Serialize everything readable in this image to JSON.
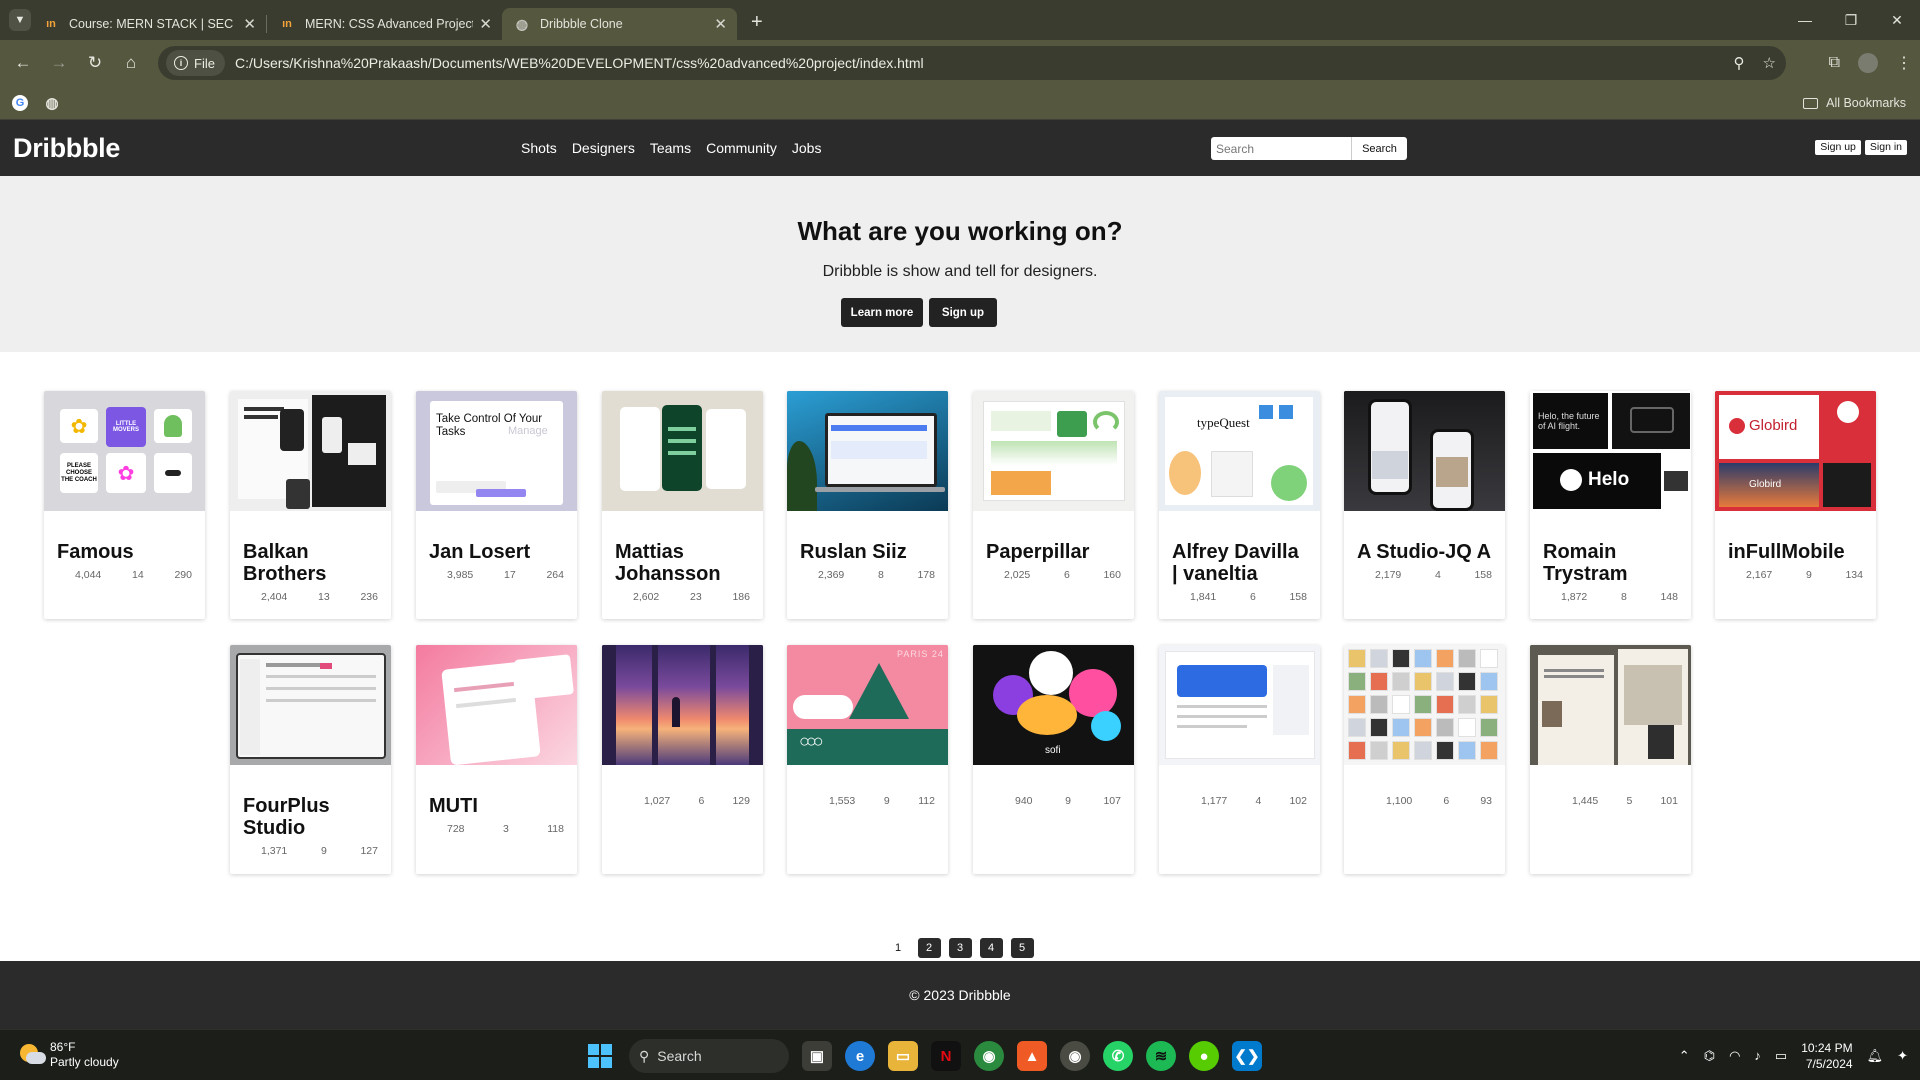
{
  "browser": {
    "tabs": [
      {
        "label": "Course: MERN STACK | SEC",
        "icon": "udemy-icon",
        "active": false
      },
      {
        "label": "MERN: CSS Advanced Project |",
        "icon": "udemy-icon",
        "active": false
      },
      {
        "label": "Dribbble Clone",
        "icon": "globe-icon",
        "active": true
      }
    ],
    "site_info_label": "File",
    "url": "C:/Users/Krishna%20Prakaash/Documents/WEB%20DEVELOPMENT/css%20advanced%20project/index.html",
    "all_bookmarks": "All Bookmarks"
  },
  "site": {
    "logo": "Dribbble",
    "nav": [
      "Shots",
      "Designers",
      "Teams",
      "Community",
      "Jobs"
    ],
    "search_placeholder": "Search",
    "search_button": "Search",
    "signup": "Sign up",
    "signin": "Sign in"
  },
  "hero": {
    "title": "What are you working on?",
    "subtitle": "Dribbble is show and tell for designers.",
    "learn_more": "Learn more",
    "sign_up": "Sign up"
  },
  "cards": [
    {
      "name": "Famous",
      "stats": [
        "4,044",
        "14",
        "290"
      ],
      "thumb": "famous",
      "bg": "#d8d8dc"
    },
    {
      "name": "Balkan Brothers",
      "stats": [
        "2,404",
        "13",
        "236"
      ],
      "thumb": "balkan",
      "bg": "#eeeeee"
    },
    {
      "name": "Jan Losert",
      "stats": [
        "3,985",
        "17",
        "264"
      ],
      "thumb": "jan",
      "bg": "#c9c8dc"
    },
    {
      "name": "Mattias Johansson",
      "stats": [
        "2,602",
        "23",
        "186"
      ],
      "thumb": "mattias",
      "bg": "#e2ddd2"
    },
    {
      "name": "Ruslan Siiz",
      "stats": [
        "2,369",
        "8",
        "178"
      ],
      "thumb": "ruslan",
      "bg": "#1b6f9a"
    },
    {
      "name": "Paperpillar",
      "stats": [
        "2,025",
        "6",
        "160"
      ],
      "thumb": "paper",
      "bg": "#f1f1ef"
    },
    {
      "name": "Alfrey Davilla | vaneltia",
      "stats": [
        "1,841",
        "6",
        "158"
      ],
      "thumb": "alfrey",
      "bg": "#e9eef4"
    },
    {
      "name": "A Studio-JQ A",
      "stats": [
        "2,179",
        "4",
        "158"
      ],
      "thumb": "astudio",
      "bg": "#2b2b2d"
    },
    {
      "name": "Romain Trystram",
      "stats": [
        "1,872",
        "8",
        "148"
      ],
      "thumb": "romain",
      "bg": "#ffffff"
    },
    {
      "name": "inFullMobile",
      "stats": [
        "2,167",
        "9",
        "134"
      ],
      "thumb": "infull",
      "bg": "#d92f3b"
    },
    {
      "name": "FourPlus Studio",
      "stats": [
        "1,371",
        "9",
        "127"
      ],
      "thumb": "fourplus",
      "bg": "#a8a9ab"
    },
    {
      "name": "MUTI",
      "stats": [
        "728",
        "3",
        "118"
      ],
      "thumb": "muti",
      "bg": "#f4b3c6"
    },
    {
      "name": "",
      "stats": [
        "1,027",
        "6",
        "129"
      ],
      "thumb": "sunset",
      "bg": "#6b4a8c"
    },
    {
      "name": "",
      "stats": [
        "1,553",
        "9",
        "112"
      ],
      "thumb": "paris",
      "bg": "#f48aa1"
    },
    {
      "name": "",
      "stats": [
        "940",
        "9",
        "107"
      ],
      "thumb": "sofi",
      "bg": "#121212"
    },
    {
      "name": "",
      "stats": [
        "1,177",
        "4",
        "102"
      ],
      "thumb": "social",
      "bg": "#f3f4f7"
    },
    {
      "name": "",
      "stats": [
        "1,100",
        "6",
        "93"
      ],
      "thumb": "collage",
      "bg": "#f5f5f5"
    },
    {
      "name": "",
      "stats": [
        "1,445",
        "5",
        "101"
      ],
      "thumb": "arch",
      "bg": "#5d5a52"
    }
  ],
  "thumb_text": {
    "famous_tile": "LITTLE MOVERS",
    "famous_coach": "PLEASE CHOOSE THE COACH",
    "jan_title": "Take Control Of Your Tasks",
    "jan_ghost": "Manage",
    "alfrey_brand": "typeQuest",
    "romain_line": "Helo, the future of AI flight.",
    "romain_brand": "Helo",
    "infull_brand": "Globird",
    "infull_small": "Globird",
    "paris_label": "PARIS 24",
    "sofi_label": "sofi"
  },
  "pagination": [
    "1",
    "2",
    "3",
    "4",
    "5"
  ],
  "footer": "© 2023 Dribbble",
  "taskbar": {
    "temp": "86°F",
    "weather": "Partly cloudy",
    "search": "Search",
    "time": "10:24 PM",
    "date": "7/5/2024"
  }
}
